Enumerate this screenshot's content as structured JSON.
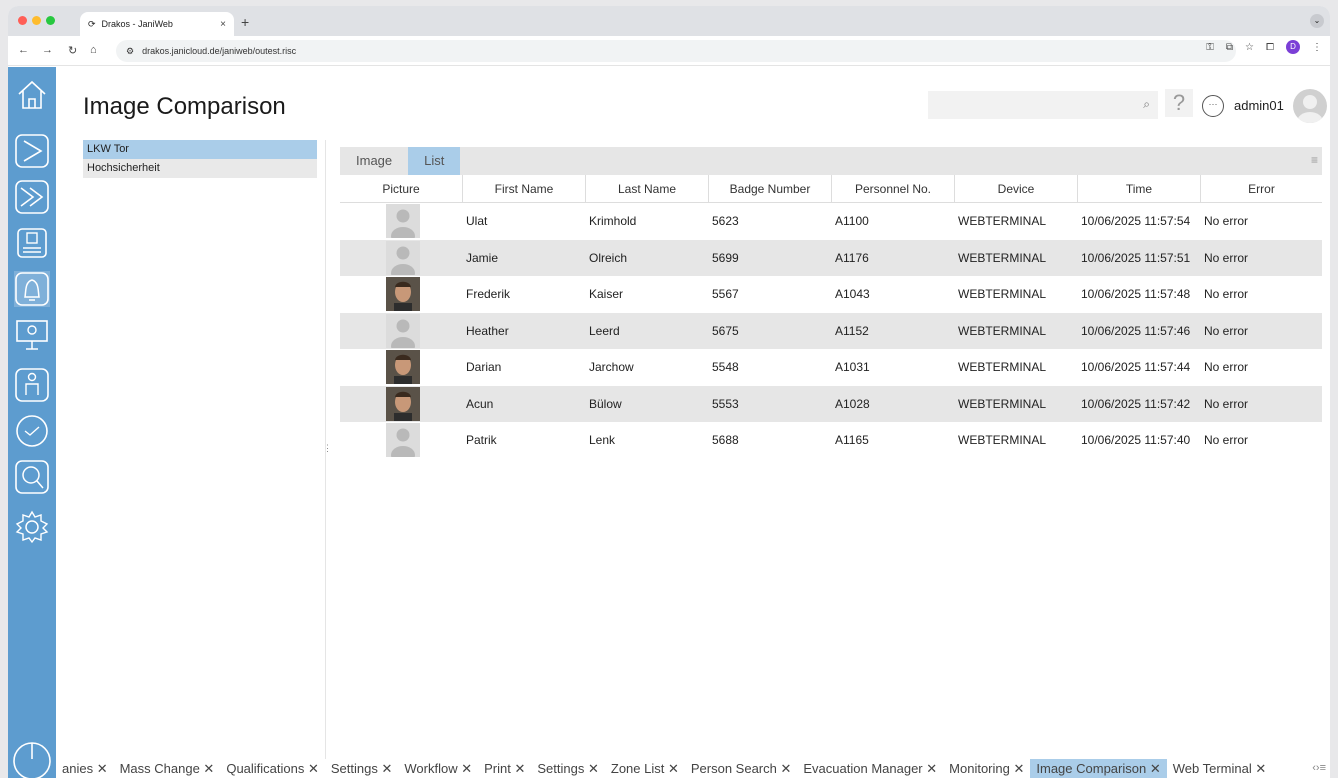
{
  "browser": {
    "tab_title": "Drakos - JaniWeb",
    "url": "drakos.janicloud.de/janiweb/outest.risc"
  },
  "header": {
    "title": "Image Comparison",
    "user": "admin01",
    "help_glyph": "?"
  },
  "tree": [
    "LKW Tor",
    "Hochsicherheit"
  ],
  "panel": {
    "tabs": [
      "Image",
      "List"
    ],
    "columns": [
      "Picture",
      "First Name",
      "Last Name",
      "Badge Number",
      "Personnel No.",
      "Device",
      "Time",
      "Error"
    ],
    "rows": [
      {
        "photo": "placeholder",
        "first": "Ulat",
        "last": "Krimhold",
        "badge": "5623",
        "pno": "A1100",
        "device": "WEBTERMINAL",
        "time": "10/06/2025 11:57:54",
        "error": "No error"
      },
      {
        "photo": "placeholder",
        "first": "Jamie",
        "last": "Olreich",
        "badge": "5699",
        "pno": "A1176",
        "device": "WEBTERMINAL",
        "time": "10/06/2025 11:57:51",
        "error": "No error"
      },
      {
        "photo": "face",
        "first": "Frederik",
        "last": "Kaiser",
        "badge": "5567",
        "pno": "A1043",
        "device": "WEBTERMINAL",
        "time": "10/06/2025 11:57:48",
        "error": "No error"
      },
      {
        "photo": "placeholder",
        "first": "Heather",
        "last": "Leerd",
        "badge": "5675",
        "pno": "A1152",
        "device": "WEBTERMINAL",
        "time": "10/06/2025 11:57:46",
        "error": "No error"
      },
      {
        "photo": "face",
        "first": "Darian",
        "last": "Jarchow",
        "badge": "5548",
        "pno": "A1031",
        "device": "WEBTERMINAL",
        "time": "10/06/2025 11:57:44",
        "error": "No error"
      },
      {
        "photo": "face",
        "first": "Acun",
        "last": "Bülow",
        "badge": "5553",
        "pno": "A1028",
        "device": "WEBTERMINAL",
        "time": "10/06/2025 11:57:42",
        "error": "No error"
      },
      {
        "photo": "placeholder",
        "first": "Patrik",
        "last": "Lenk",
        "badge": "5688",
        "pno": "A1165",
        "device": "WEBTERMINAL",
        "time": "10/06/2025 11:57:40",
        "error": "No error"
      }
    ]
  },
  "bottom_tabs": [
    "anies",
    "Mass Change",
    "Qualifications",
    "Settings",
    "Workflow",
    "Print",
    "Settings",
    "Zone List",
    "Person Search",
    "Evacuation Manager",
    "Monitoring",
    "Image Comparison",
    "Web Terminal"
  ],
  "bottom_tab_active": "Image Comparison",
  "colors": {
    "sidebar": "#5d9ccf",
    "selection": "#aacde9"
  }
}
